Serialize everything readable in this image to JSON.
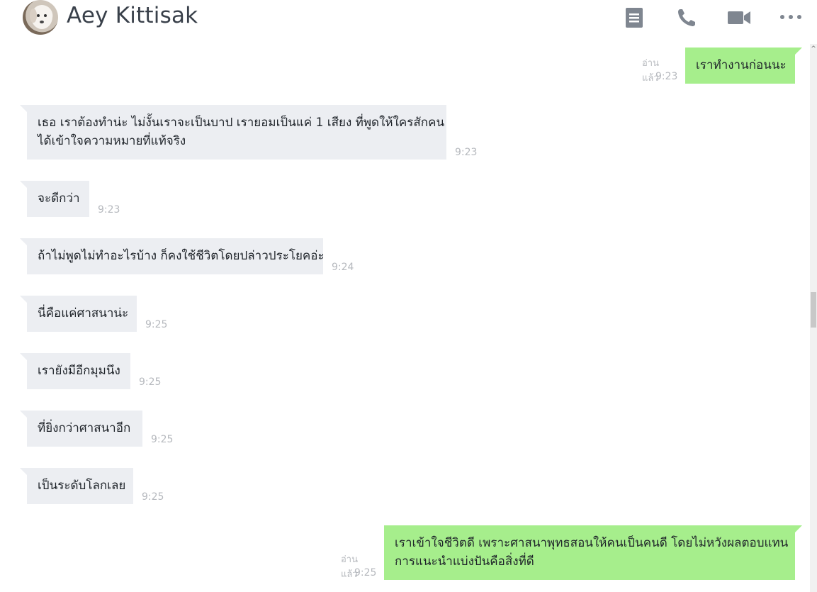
{
  "header": {
    "contact_name": "Aey Kittisak",
    "icons": [
      "notes-icon",
      "phone-icon",
      "video-icon",
      "more-icon"
    ]
  },
  "messages": [
    {
      "dir": "out",
      "lines": [
        "เราทำงานก่อนนะ"
      ],
      "read": "อ่านแล้ว",
      "time": "9:23"
    },
    {
      "dir": "in",
      "lines": [
        "เธอ เราต้องทำน่ะ ไม่งั้นเราจะเป็นบาป เรายอมเป็นแค่ 1 เสียง ที่พูดให้ใครสักคน",
        "ได้เข้าใจความหมายที่แท้จริง"
      ],
      "time": "9:23"
    },
    {
      "dir": "in",
      "lines": [
        "จะดีกว่า"
      ],
      "time": "9:23"
    },
    {
      "dir": "in",
      "lines": [
        "ถ้าไม่พูดไม่ทำอะไรบ้าง ก็คงใช้ชีวิตโดยปล่าวประโยคอ่ะ"
      ],
      "time": "9:24"
    },
    {
      "dir": "in",
      "lines": [
        "นี่คือแค่ศาสนาน่ะ"
      ],
      "time": "9:25"
    },
    {
      "dir": "in",
      "lines": [
        "เรายังมีอีกมุมนึง"
      ],
      "time": "9:25"
    },
    {
      "dir": "in",
      "lines": [
        "ที่ยิ่งกว่าศาสนาอีก"
      ],
      "time": "9:25"
    },
    {
      "dir": "in",
      "lines": [
        "เป็นระดับโลกเลย"
      ],
      "time": "9:25"
    },
    {
      "dir": "out",
      "lines": [
        "เราเข้าใจชีวิตดี เพราะศาสนาพุทธสอนให้คนเป็นคนดี โดยไม่หวังผลตอบแทน",
        "การแนะนำแบ่งปันคือสิ่งที่ดี"
      ],
      "read": "อ่านแล้ว",
      "time": "9:25"
    }
  ]
}
